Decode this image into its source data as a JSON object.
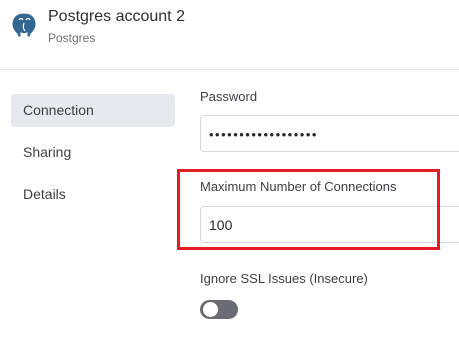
{
  "header": {
    "title": "Postgres account 2",
    "subtitle": "Postgres",
    "logo_icon": "postgres-elephant-icon"
  },
  "sidebar": {
    "items": [
      {
        "label": "Connection",
        "active": true
      },
      {
        "label": "Sharing",
        "active": false
      },
      {
        "label": "Details",
        "active": false
      }
    ]
  },
  "form": {
    "password": {
      "label": "Password",
      "value": "••••••••••••••••••"
    },
    "max_connections": {
      "label": "Maximum Number of Connections",
      "value": "100"
    },
    "ignore_ssl": {
      "label": "Ignore SSL Issues (Insecure)",
      "enabled": false
    }
  },
  "colors": {
    "highlight": "#e41c24",
    "active_nav_bg": "#e8e8ef",
    "toggle_off": "#6b6b73"
  }
}
